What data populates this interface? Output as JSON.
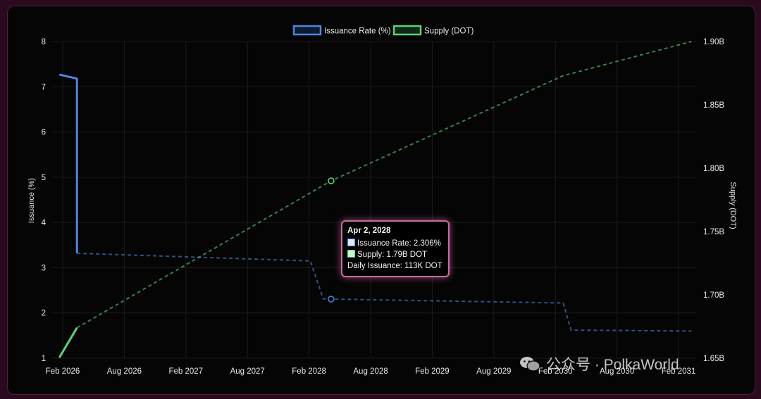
{
  "chart_data": {
    "type": "line",
    "legend": {
      "position": "top-center",
      "items": [
        "Issuance Rate (%)",
        "Supply (DOT)"
      ]
    },
    "x_ticks": [
      "Feb 2026",
      "Aug 2026",
      "Feb 2027",
      "Aug 2027",
      "Feb 2028",
      "Aug 2028",
      "Feb 2029",
      "Aug 2029",
      "Feb 2030",
      "Aug 2030",
      "Feb 2031"
    ],
    "y_left": {
      "label": "Issuance (%)",
      "range": [
        1,
        8
      ],
      "ticks": [
        "1",
        "2",
        "3",
        "4",
        "5",
        "6",
        "7",
        "8"
      ]
    },
    "y_right": {
      "label": "Supply (DOT)",
      "range": [
        1.65,
        1.9
      ],
      "ticks": [
        "1.65B",
        "1.70B",
        "1.75B",
        "1.80B",
        "1.85B",
        "1.90B"
      ]
    },
    "grid": true,
    "series": [
      {
        "name": "Issuance Rate (%)",
        "axis": "left",
        "color": "#4f86dc",
        "solid": [
          [
            "2026-01-22",
            7.27
          ],
          [
            "2026-03-15",
            7.18
          ],
          [
            "2026-03-15",
            3.32
          ]
        ],
        "dashed": [
          [
            "2026-03-15",
            3.32
          ],
          [
            "2028-02-01",
            3.15
          ],
          [
            "2028-03-10",
            2.31
          ],
          [
            "2030-02-15",
            2.22
          ],
          [
            "2030-03-10",
            1.62
          ],
          [
            "2031-02-28",
            1.6
          ]
        ],
        "highlight": [
          "2028-04-02",
          2.306
        ]
      },
      {
        "name": "Supply (DOT)",
        "axis": "right",
        "color": "#5fd07a",
        "solid": [
          [
            "2026-01-22",
            1.6505
          ],
          [
            "2026-03-15",
            1.674
          ]
        ],
        "dashed": [
          [
            "2026-03-15",
            1.674
          ],
          [
            "2028-04-02",
            1.79
          ],
          [
            "2030-02-15",
            1.873
          ],
          [
            "2031-02-28",
            1.9
          ]
        ],
        "highlight": [
          "2028-04-02",
          1.79
        ]
      }
    ],
    "tooltip": {
      "title": "Apr 2, 2028",
      "rate": "Issuance Rate: 2.306%",
      "supply": "Supply: 1.79B DOT",
      "daily": "Daily Issuance: 113K DOT"
    }
  },
  "watermark": {
    "text": "公众号 · PolkaWorld",
    "icon": "wechat-icon"
  },
  "colors": {
    "background": "#050505",
    "grid": "#1c1c1c",
    "axis_text": "#e8e8e8",
    "rate": "#4f86dc",
    "supply": "#5fd07a",
    "tooltip_border": "#c46fa2"
  }
}
